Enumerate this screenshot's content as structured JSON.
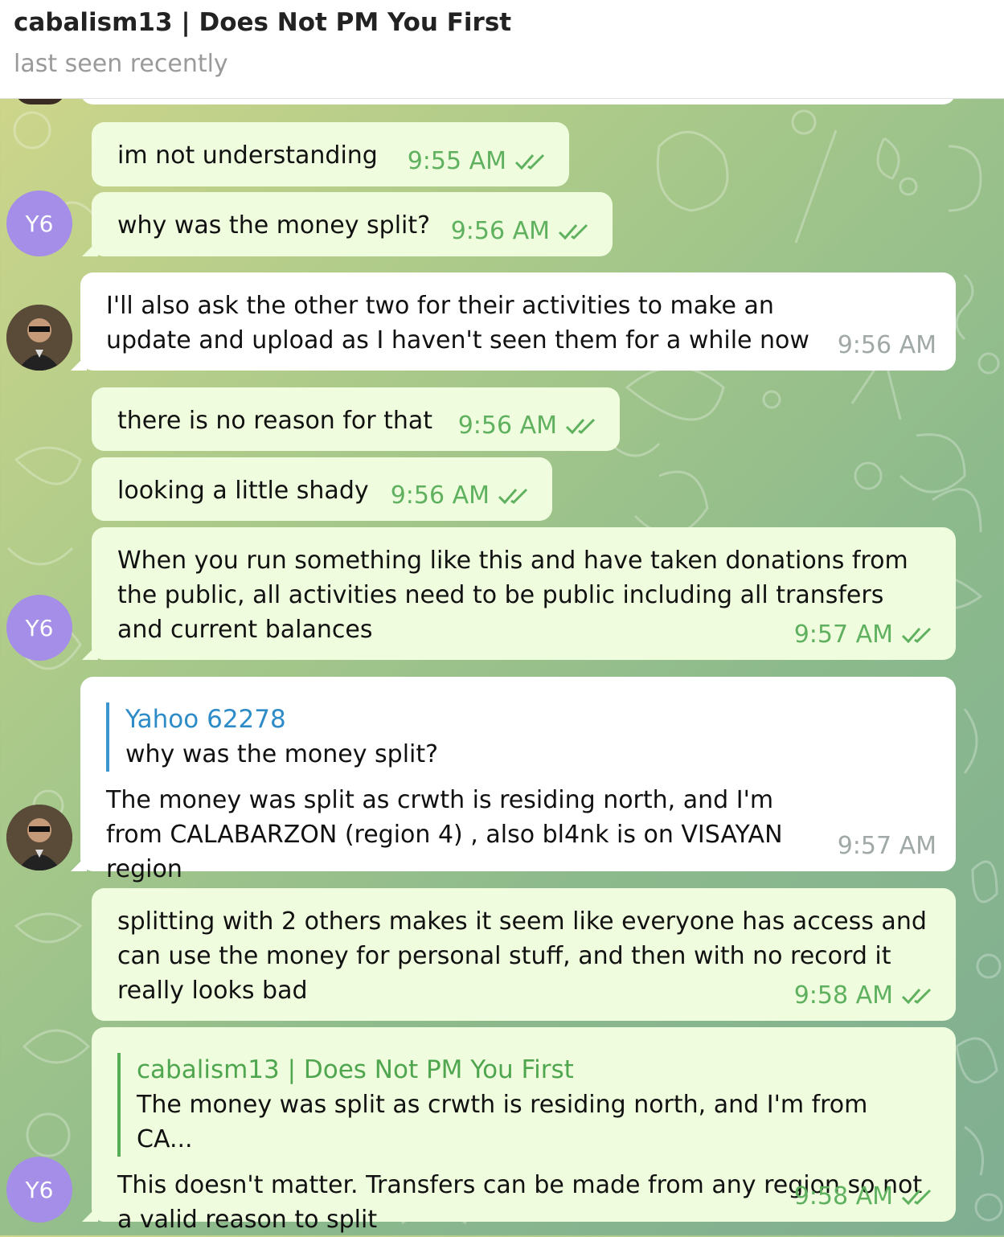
{
  "header": {
    "title": "cabalism13 | Does Not PM You First",
    "status": "last seen recently"
  },
  "avatars": {
    "y6": "Y6"
  },
  "colors": {
    "outgoing_bubble": "#effdde",
    "incoming_bubble": "#ffffff",
    "check": "#5fb15f",
    "reply_blue": "#3c95cf",
    "reply_green": "#55ae55"
  },
  "messages": [
    {
      "text": "im not understanding",
      "time": "9:55 AM",
      "direction": "out",
      "read": true
    },
    {
      "text": "why was the money split?",
      "time": "9:56 AM",
      "direction": "out",
      "read": true
    },
    {
      "text": "I'll also ask the other two for their activities to make an update and upload as I haven't seen them for a while now",
      "time": "9:56 AM",
      "direction": "in"
    },
    {
      "text": "there is no reason for that",
      "time": "9:56 AM",
      "direction": "out",
      "read": true
    },
    {
      "text": "looking a little shady",
      "time": "9:56 AM",
      "direction": "out",
      "read": true
    },
    {
      "text": "When you run something like this and have taken donations from the public, all activities need to be public including all transfers and current balances",
      "time": "9:57 AM",
      "direction": "out",
      "read": true
    },
    {
      "reply": {
        "name": "Yahoo 62278",
        "text": "why was the money split?"
      },
      "text": "The money was split as crwth is residing north, and I'm from CALABARZON (region 4) , also bl4nk is on VISAYAN region",
      "time": "9:57 AM",
      "direction": "in"
    },
    {
      "text": "splitting with 2 others makes it seem like everyone has access and can use the money for personal stuff, and then with no record it really looks bad",
      "time": "9:58 AM",
      "direction": "out",
      "read": true
    },
    {
      "reply": {
        "name": "cabalism13 | Does Not PM You First",
        "text": "The money was split as crwth is residing north, and I'm from CA..."
      },
      "text": "This doesn't matter. Transfers can be made from any region so not a valid reason to split",
      "time": "9:58 AM",
      "direction": "out",
      "read": true
    }
  ]
}
